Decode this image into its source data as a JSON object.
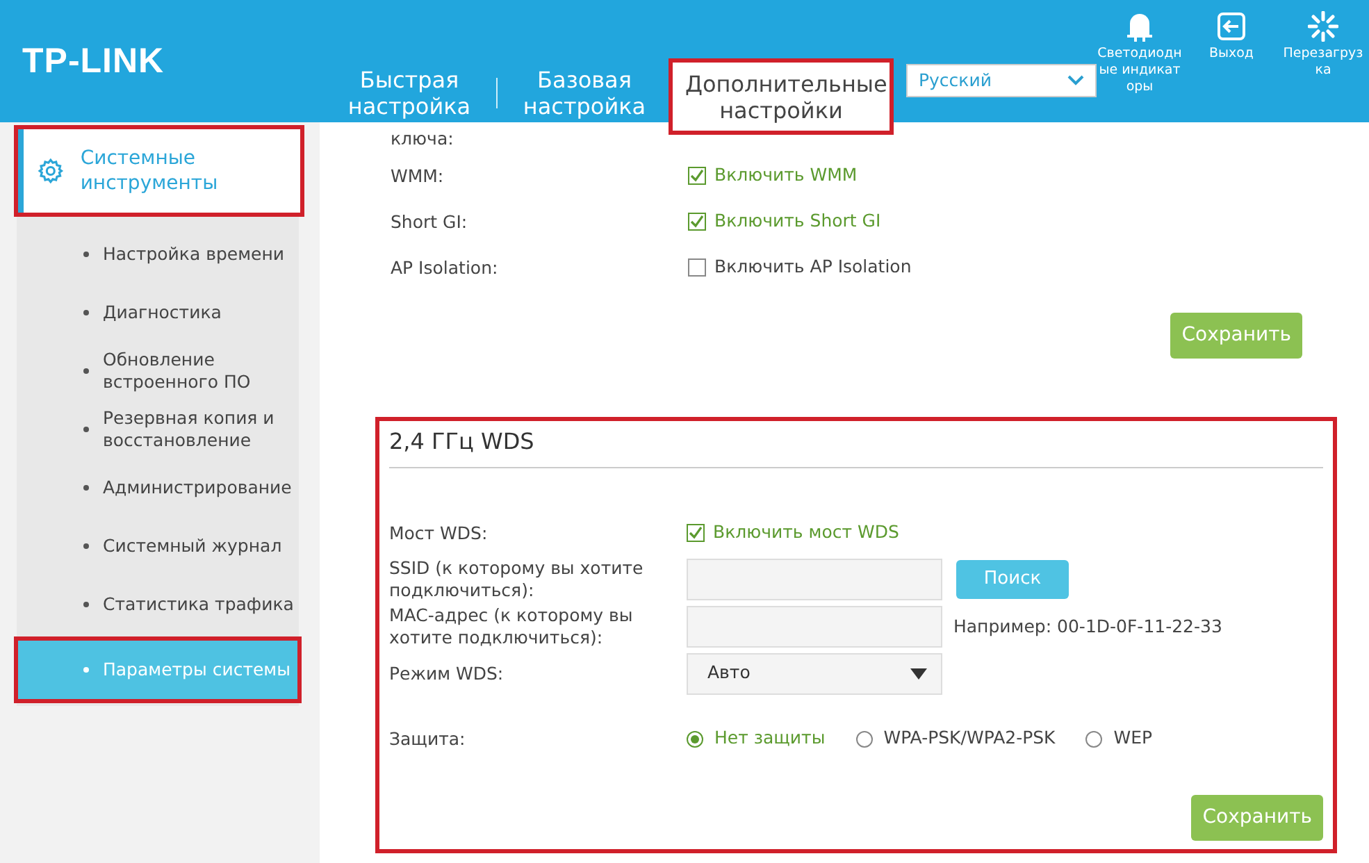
{
  "header": {
    "logo": "TP-LINK",
    "tabs": [
      {
        "label": "Быстрая настройка",
        "selected": false,
        "highlighted": false
      },
      {
        "label": "Базовая настройка",
        "selected": false,
        "highlighted": false
      },
      {
        "label": "Дополнительные настройки",
        "selected": true,
        "highlighted": true
      }
    ],
    "language": {
      "value": "Русский"
    },
    "actions": [
      {
        "kind": "led",
        "label": "Светодиодные индикаторы"
      },
      {
        "kind": "logout",
        "label": "Выход"
      },
      {
        "kind": "reboot",
        "label": "Перезагрузка"
      }
    ]
  },
  "sidebar": {
    "section": {
      "label": "Системные инструменты",
      "highlighted": true
    },
    "items": [
      {
        "label": "Настройка времени",
        "selected": false,
        "highlighted": false
      },
      {
        "label": "Диагностика",
        "selected": false,
        "highlighted": false
      },
      {
        "label": "Обновление встроенного ПО",
        "selected": false,
        "highlighted": false
      },
      {
        "label": "Резервная копия и восстановление",
        "selected": false,
        "highlighted": false
      },
      {
        "label": "Администрирование",
        "selected": false,
        "highlighted": false
      },
      {
        "label": "Системный журнал",
        "selected": false,
        "highlighted": false
      },
      {
        "label": "Статистика трафика",
        "selected": false,
        "highlighted": false
      },
      {
        "label": "Параметры системы",
        "selected": true,
        "highlighted": true
      }
    ]
  },
  "wireless": {
    "cut_label": "ключа:",
    "options": [
      {
        "label": "WMM:",
        "option": "Включить WMM",
        "checked": true
      },
      {
        "label": "Short GI:",
        "option": "Включить Short GI",
        "checked": true
      },
      {
        "label": "AP Isolation:",
        "option": "Включить AP Isolation",
        "checked": false
      }
    ],
    "save_button": "Сохранить"
  },
  "wds": {
    "title": "2,4 ГГц WDS",
    "highlighted": true,
    "rows": [
      {
        "kind": "checkbox",
        "label": "Мост WDS:",
        "option": "Включить мост WDS",
        "checked": true
      },
      {
        "kind": "text",
        "label": "SSID (к которому вы хотите подключиться):",
        "button": "Поиск"
      },
      {
        "kind": "text",
        "label": "MAC-адрес (к которому вы хотите подключиться):",
        "hint": "Например: 00-1D-0F-11-22-33"
      },
      {
        "kind": "select",
        "label": "Режим WDS:",
        "value": "Авто"
      },
      {
        "kind": "radio",
        "label": "Защита:",
        "options": [
          {
            "label": "Нет защиты",
            "selected": true
          },
          {
            "label": "WPA-PSK/WPA2-PSK",
            "selected": false
          },
          {
            "label": "WEP",
            "selected": false
          }
        ]
      }
    ],
    "save_button": "Сохранить"
  }
}
